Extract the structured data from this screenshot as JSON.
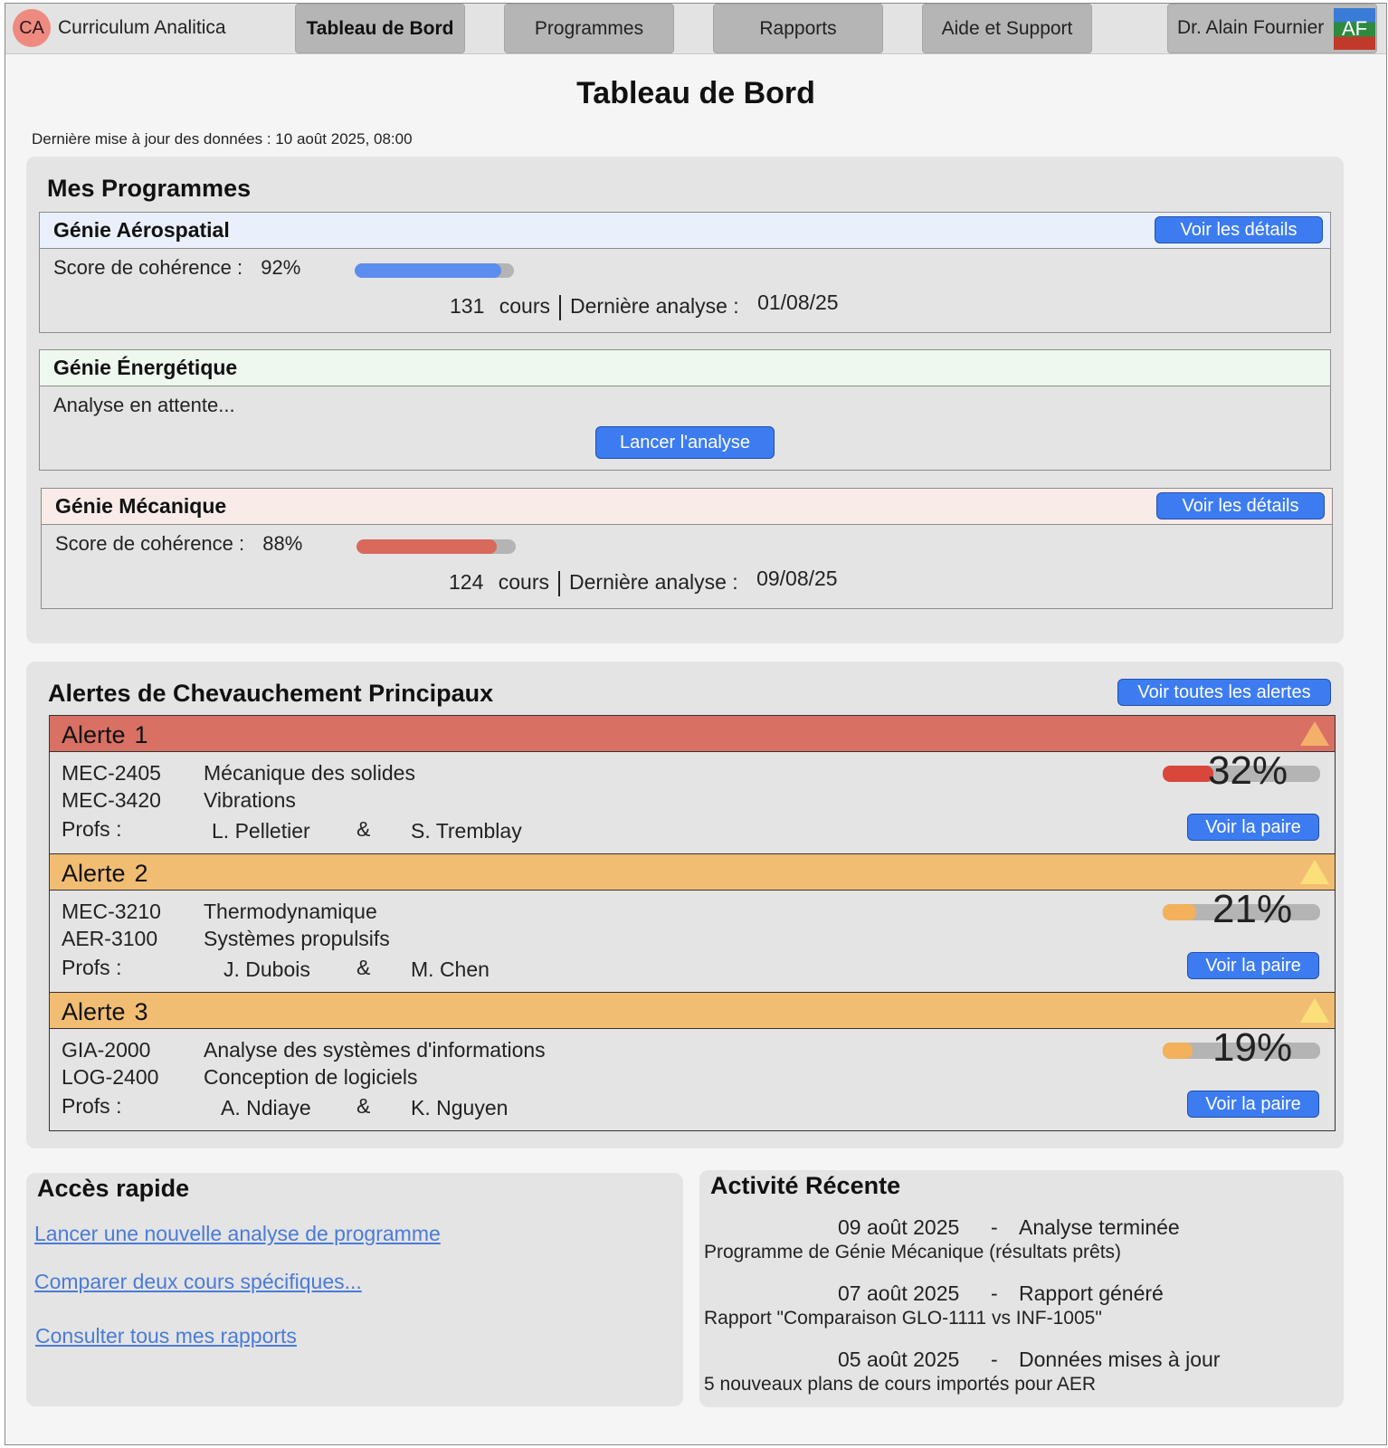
{
  "app": {
    "logo_initials": "CA",
    "name": "Curriculum Analitica"
  },
  "nav": {
    "tabs": [
      {
        "label": "Tableau de Bord",
        "active": true
      },
      {
        "label": "Programmes",
        "active": false
      },
      {
        "label": "Rapports",
        "active": false
      },
      {
        "label": "Aide et Support",
        "active": false
      }
    ],
    "user_name": "Dr. Alain Fournier",
    "user_initials": "AF"
  },
  "page": {
    "title": "Tableau de Bord",
    "last_update": "Dernière mise à jour des données : 10 août 2025, 08:00"
  },
  "programs": {
    "title": "Mes Programmes",
    "items": [
      {
        "name": "Génie Aérospatial",
        "header_color": "#e9f0fb",
        "button": "Voir les détails",
        "score_label": "Score de cohérence :",
        "score": "92%",
        "score_value": 0.92,
        "bar_color": "#5b8def",
        "courses": "131",
        "courses_label": "cours",
        "last_label": "Dernière analyse :",
        "last_date": "01/08/25"
      },
      {
        "name": "Génie Énergétique",
        "header_color": "#eef8ef",
        "pending_text": "Analyse en attente...",
        "button": "Lancer l'analyse"
      },
      {
        "name": "Génie Mécanique",
        "header_color": "#f8ebe8",
        "button": "Voir les détails",
        "score_label": "Score de cohérence :",
        "score": "88%",
        "score_value": 0.88,
        "bar_color": "#d9695a",
        "courses": "124",
        "courses_label": "cours",
        "last_label": "Dernière analyse :",
        "last_date": "09/08/25"
      }
    ]
  },
  "alerts": {
    "title": "Alertes de Chevauchement Principaux",
    "view_all": "Voir toutes les alertes",
    "profs_label": "Profs :",
    "amp": "&",
    "pair_button": "Voir la paire",
    "items": [
      {
        "label": "Alerte",
        "number": "1",
        "header_color": "#d87064",
        "tri_color": "#f4b06a",
        "course1_code": "MEC-2405",
        "course1_name": "Mécanique des solides",
        "course2_code": "MEC-3420",
        "course2_name": "Vibrations",
        "prof1": "L. Pelletier",
        "prof2": "S. Tremblay",
        "pct": "32%",
        "pct_value": 0.32,
        "bar_color": "#d9473b"
      },
      {
        "label": "Alerte",
        "number": "2",
        "header_color": "#f1bd73",
        "tri_color": "#fbe07a",
        "course1_code": "MEC-3210",
        "course1_name": "Thermodynamique",
        "course2_code": "AER-3100",
        "course2_name": "Systèmes propulsifs",
        "prof1": "J. Dubois",
        "prof2": "M. Chen",
        "pct": "21%",
        "pct_value": 0.21,
        "bar_color": "#f2b15a"
      },
      {
        "label": "Alerte",
        "number": "3",
        "header_color": "#f1bd73",
        "tri_color": "#fbe07a",
        "course1_code": "GIA-2000",
        "course1_name": "Analyse des systèmes d'informations",
        "course2_code": "LOG-2400",
        "course2_name": "Conception de logiciels",
        "prof1": "A. Ndiaye",
        "prof2": "K. Nguyen",
        "pct": "19%",
        "pct_value": 0.19,
        "bar_color": "#f2b15a"
      }
    ]
  },
  "quick_access": {
    "title": "Accès rapide",
    "links": [
      "Lancer une nouvelle analyse de programme",
      "Comparer deux cours spécifiques...",
      "Consulter tous mes rapports"
    ]
  },
  "activity": {
    "title": "Activité Récente",
    "items": [
      {
        "date": "09 août 2025",
        "dash": "-",
        "event": "Analyse terminée",
        "desc": "Programme de Génie Mécanique (résultats prêts)"
      },
      {
        "date": "07 août 2025",
        "dash": "-",
        "event": "Rapport généré",
        "desc": "Rapport \"Comparaison GLO-1111 vs INF-1005\""
      },
      {
        "date": "05 août 2025",
        "dash": "-",
        "event": "Données mises à jour",
        "desc": "5 nouveaux plans de cours importés pour AER"
      }
    ]
  }
}
